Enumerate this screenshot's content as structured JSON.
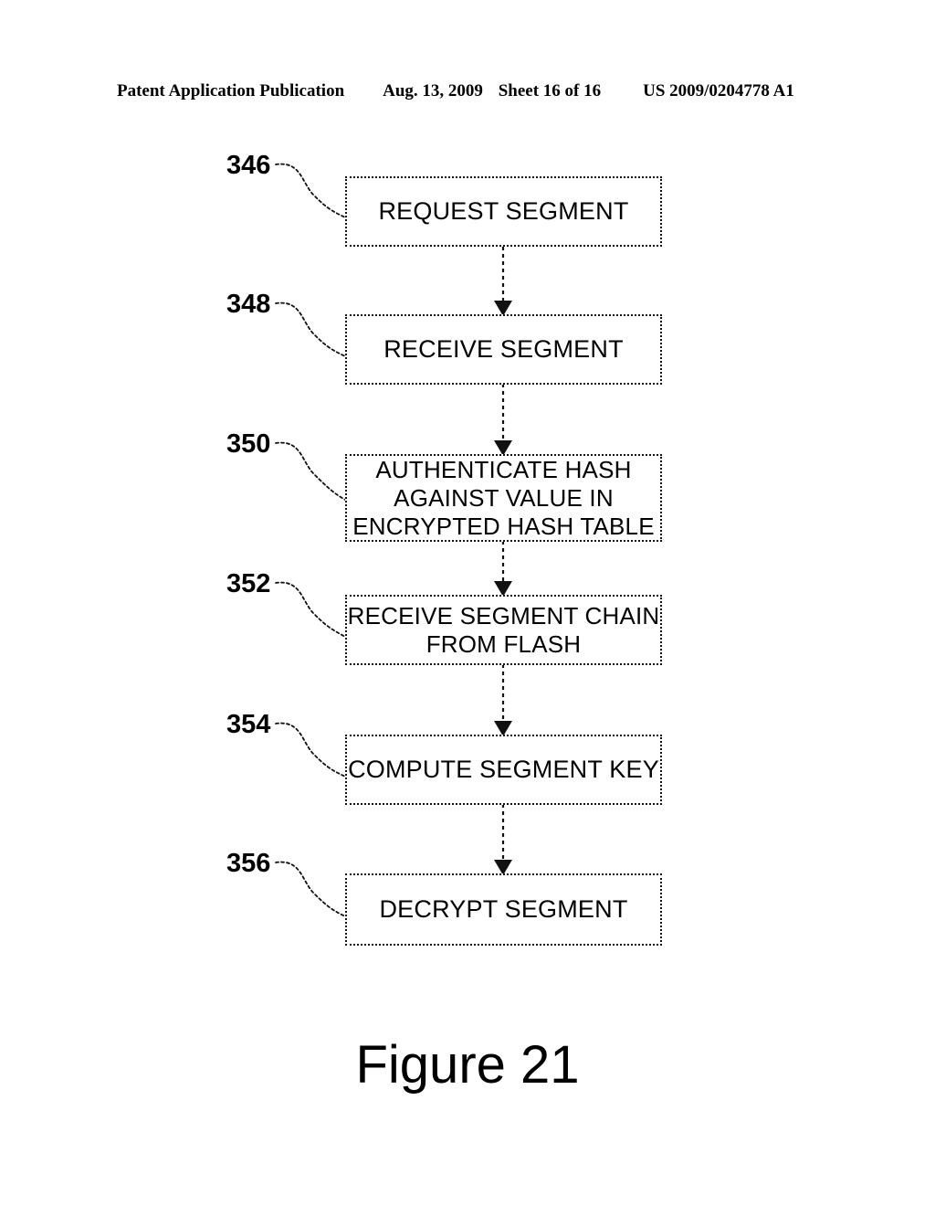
{
  "header": {
    "publication": "Patent Application Publication",
    "date": "Aug. 13, 2009",
    "sheet": "Sheet 16 of 16",
    "publication_number": "US 2009/0204778 A1"
  },
  "figure": {
    "caption": "Figure 21",
    "type": "flowchart",
    "line_style": "dotted",
    "connector_style": "dashed-with-solid-arrowhead",
    "ink_color": "#000000",
    "background_color": "#ffffff"
  },
  "flow": {
    "steps": [
      {
        "ref": "346",
        "label": "REQUEST SEGMENT"
      },
      {
        "ref": "348",
        "label": "RECEIVE SEGMENT"
      },
      {
        "ref": "350",
        "label": "AUTHENTICATE HASH\nAGAINST VALUE IN\nENCRYPTED HASH TABLE"
      },
      {
        "ref": "352",
        "label": "RECEIVE SEGMENT CHAIN\nFROM FLASH"
      },
      {
        "ref": "354",
        "label": "COMPUTE SEGMENT KEY"
      },
      {
        "ref": "356",
        "label": "DECRYPT SEGMENT"
      }
    ]
  }
}
